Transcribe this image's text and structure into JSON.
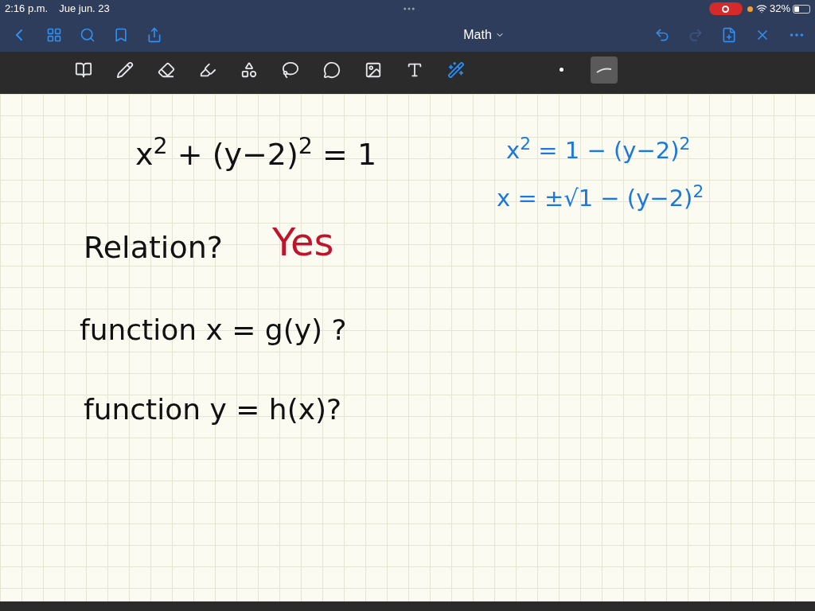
{
  "status_bar": {
    "time": "2:16 p.m.",
    "date": "Jue jun. 23",
    "battery": "32%"
  },
  "nav_bar": {
    "title": "Math"
  },
  "tools": [
    {
      "kind": "zoom",
      "selected": false
    },
    {
      "kind": "pen",
      "selected": false
    },
    {
      "kind": "eraser",
      "selected": false
    },
    {
      "kind": "highlighter",
      "selected": false
    },
    {
      "kind": "shapes",
      "selected": false
    },
    {
      "kind": "lasso",
      "selected": false
    },
    {
      "kind": "sticker",
      "selected": false
    },
    {
      "kind": "image",
      "selected": false
    },
    {
      "kind": "text",
      "selected": false
    },
    {
      "kind": "laser",
      "selected": false
    },
    {
      "kind": "dot",
      "selected": false
    },
    {
      "kind": "stroke",
      "selected": true
    }
  ],
  "ink": [
    {
      "text": "x$^{2}$ + (y−2)$^{2}$ = 1",
      "color": "#111111"
    },
    {
      "text": "Relation?",
      "color": "#111111"
    },
    {
      "text": "Yes",
      "color": "#c0142b"
    },
    {
      "text": "function  x = g(y) ?",
      "color": "#111111"
    },
    {
      "text": "function  y = h(x)?",
      "color": "#111111"
    },
    {
      "text": "x$^{2}$ = 1 − (y−2)$^{2}$",
      "color": "#1a78e0"
    },
    {
      "text": "x = ±√1 − (y−2)$^{2}$",
      "color": "#1a78e0"
    }
  ]
}
